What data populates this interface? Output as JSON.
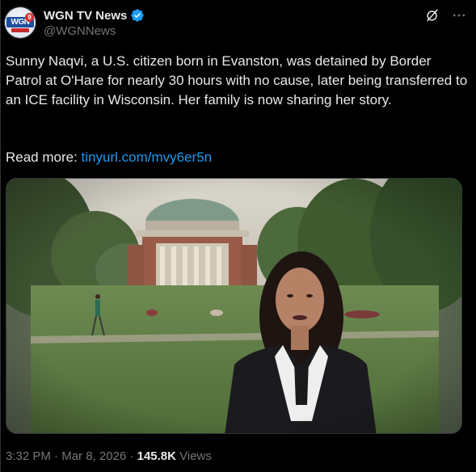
{
  "author": {
    "display_name": "WGN TV News",
    "handle": "@WGNNews",
    "verified": true,
    "avatar_text": "WGN",
    "avatar_badge": "9"
  },
  "tweet": {
    "text": "Sunny Naqvi, a U.S. citizen born in Evanston, was detained by Border Patrol at O'Hare for nearly 30 hours with no cause, later being transferred to an ICE facility in Wisconsin. Her family is now sharing her story.",
    "read_more_label": "Read more: ",
    "link_text": "tinyurl.com/mvy6er5n"
  },
  "meta": {
    "time": "3:32 PM",
    "separator": " · ",
    "date": "Mar 8, 2026",
    "views_count": "145.8K",
    "views_label": " Views"
  },
  "icons": {
    "verified": "verified-badge-icon",
    "grok": "grok-icon",
    "more": "more-options-icon"
  },
  "colors": {
    "background": "#000000",
    "text": "#e7e9ea",
    "muted": "#71767b",
    "link": "#1d9bf0",
    "verified": "#1d9bf0"
  }
}
